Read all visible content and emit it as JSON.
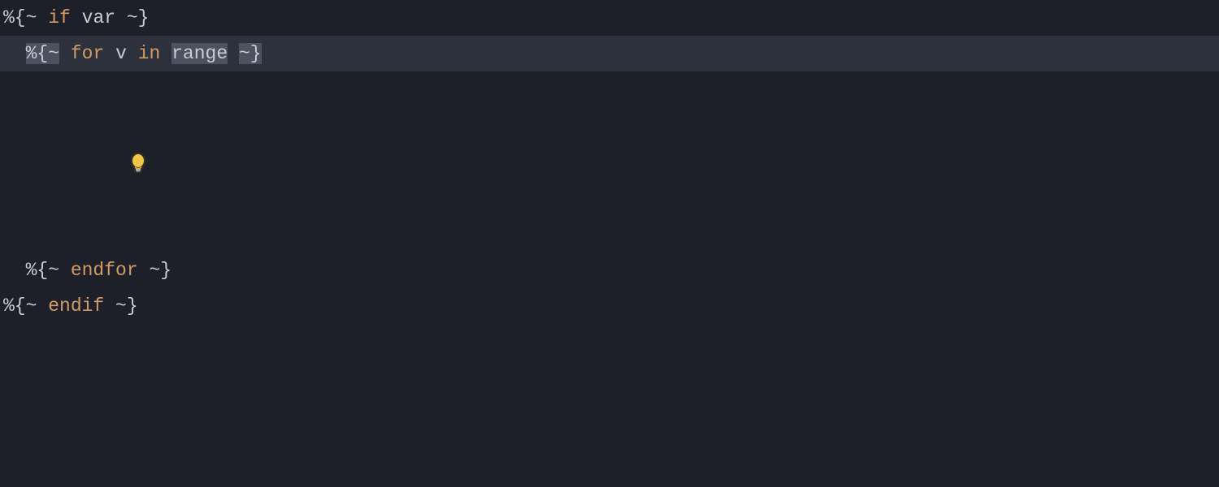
{
  "editor": {
    "lines": {
      "l1": {
        "open": "%{~ ",
        "kw": "if",
        "sp1": " ",
        "arg": "var",
        "close": " ~}"
      },
      "l2": {
        "indent": "  ",
        "open": "%{~",
        "sp0": " ",
        "kw": "for",
        "sp1": " ",
        "v": "v",
        "sp2": " ",
        "in": "in",
        "sp3": " ",
        "range": "range",
        "sp4": " ",
        "close": "~}"
      },
      "l4": {
        "indent": "  ",
        "open": "%{~ ",
        "kw": "endfor",
        "close": " ~}"
      },
      "l5": {
        "open": "%{~ ",
        "kw": "endif",
        "close": " ~}"
      }
    }
  },
  "icons": {
    "lightbulb": "lightbulb-icon"
  }
}
